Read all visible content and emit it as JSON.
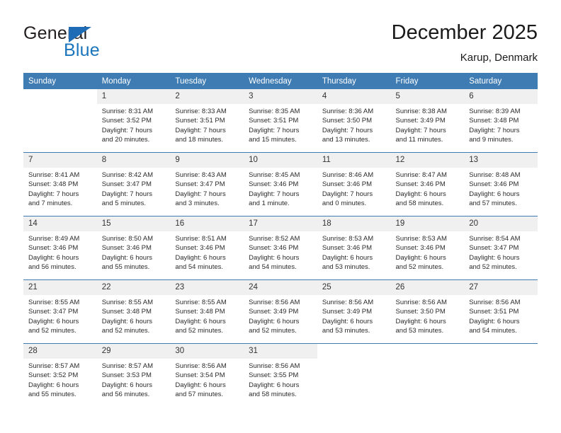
{
  "brand": {
    "name_top": "General",
    "name_bottom": "Blue",
    "accent_color": "#1b75bc",
    "triangle_color": "#1d6cb5"
  },
  "header": {
    "title": "December 2025",
    "subtitle": "Karup, Denmark"
  },
  "calendar": {
    "header_background": "#3f7cb3",
    "daynum_background": "#f0f0f0",
    "weekdays": [
      "Sunday",
      "Monday",
      "Tuesday",
      "Wednesday",
      "Thursday",
      "Friday",
      "Saturday"
    ],
    "weeks": [
      [
        {
          "day": "",
          "sunrise": "",
          "sunset": "",
          "daylight_line1": "",
          "daylight_line2": ""
        },
        {
          "day": "1",
          "sunrise": "Sunrise: 8:31 AM",
          "sunset": "Sunset: 3:52 PM",
          "daylight_line1": "Daylight: 7 hours",
          "daylight_line2": "and 20 minutes."
        },
        {
          "day": "2",
          "sunrise": "Sunrise: 8:33 AM",
          "sunset": "Sunset: 3:51 PM",
          "daylight_line1": "Daylight: 7 hours",
          "daylight_line2": "and 18 minutes."
        },
        {
          "day": "3",
          "sunrise": "Sunrise: 8:35 AM",
          "sunset": "Sunset: 3:51 PM",
          "daylight_line1": "Daylight: 7 hours",
          "daylight_line2": "and 15 minutes."
        },
        {
          "day": "4",
          "sunrise": "Sunrise: 8:36 AM",
          "sunset": "Sunset: 3:50 PM",
          "daylight_line1": "Daylight: 7 hours",
          "daylight_line2": "and 13 minutes."
        },
        {
          "day": "5",
          "sunrise": "Sunrise: 8:38 AM",
          "sunset": "Sunset: 3:49 PM",
          "daylight_line1": "Daylight: 7 hours",
          "daylight_line2": "and 11 minutes."
        },
        {
          "day": "6",
          "sunrise": "Sunrise: 8:39 AM",
          "sunset": "Sunset: 3:48 PM",
          "daylight_line1": "Daylight: 7 hours",
          "daylight_line2": "and 9 minutes."
        }
      ],
      [
        {
          "day": "7",
          "sunrise": "Sunrise: 8:41 AM",
          "sunset": "Sunset: 3:48 PM",
          "daylight_line1": "Daylight: 7 hours",
          "daylight_line2": "and 7 minutes."
        },
        {
          "day": "8",
          "sunrise": "Sunrise: 8:42 AM",
          "sunset": "Sunset: 3:47 PM",
          "daylight_line1": "Daylight: 7 hours",
          "daylight_line2": "and 5 minutes."
        },
        {
          "day": "9",
          "sunrise": "Sunrise: 8:43 AM",
          "sunset": "Sunset: 3:47 PM",
          "daylight_line1": "Daylight: 7 hours",
          "daylight_line2": "and 3 minutes."
        },
        {
          "day": "10",
          "sunrise": "Sunrise: 8:45 AM",
          "sunset": "Sunset: 3:46 PM",
          "daylight_line1": "Daylight: 7 hours",
          "daylight_line2": "and 1 minute."
        },
        {
          "day": "11",
          "sunrise": "Sunrise: 8:46 AM",
          "sunset": "Sunset: 3:46 PM",
          "daylight_line1": "Daylight: 7 hours",
          "daylight_line2": "and 0 minutes."
        },
        {
          "day": "12",
          "sunrise": "Sunrise: 8:47 AM",
          "sunset": "Sunset: 3:46 PM",
          "daylight_line1": "Daylight: 6 hours",
          "daylight_line2": "and 58 minutes."
        },
        {
          "day": "13",
          "sunrise": "Sunrise: 8:48 AM",
          "sunset": "Sunset: 3:46 PM",
          "daylight_line1": "Daylight: 6 hours",
          "daylight_line2": "and 57 minutes."
        }
      ],
      [
        {
          "day": "14",
          "sunrise": "Sunrise: 8:49 AM",
          "sunset": "Sunset: 3:46 PM",
          "daylight_line1": "Daylight: 6 hours",
          "daylight_line2": "and 56 minutes."
        },
        {
          "day": "15",
          "sunrise": "Sunrise: 8:50 AM",
          "sunset": "Sunset: 3:46 PM",
          "daylight_line1": "Daylight: 6 hours",
          "daylight_line2": "and 55 minutes."
        },
        {
          "day": "16",
          "sunrise": "Sunrise: 8:51 AM",
          "sunset": "Sunset: 3:46 PM",
          "daylight_line1": "Daylight: 6 hours",
          "daylight_line2": "and 54 minutes."
        },
        {
          "day": "17",
          "sunrise": "Sunrise: 8:52 AM",
          "sunset": "Sunset: 3:46 PM",
          "daylight_line1": "Daylight: 6 hours",
          "daylight_line2": "and 54 minutes."
        },
        {
          "day": "18",
          "sunrise": "Sunrise: 8:53 AM",
          "sunset": "Sunset: 3:46 PM",
          "daylight_line1": "Daylight: 6 hours",
          "daylight_line2": "and 53 minutes."
        },
        {
          "day": "19",
          "sunrise": "Sunrise: 8:53 AM",
          "sunset": "Sunset: 3:46 PM",
          "daylight_line1": "Daylight: 6 hours",
          "daylight_line2": "and 52 minutes."
        },
        {
          "day": "20",
          "sunrise": "Sunrise: 8:54 AM",
          "sunset": "Sunset: 3:47 PM",
          "daylight_line1": "Daylight: 6 hours",
          "daylight_line2": "and 52 minutes."
        }
      ],
      [
        {
          "day": "21",
          "sunrise": "Sunrise: 8:55 AM",
          "sunset": "Sunset: 3:47 PM",
          "daylight_line1": "Daylight: 6 hours",
          "daylight_line2": "and 52 minutes."
        },
        {
          "day": "22",
          "sunrise": "Sunrise: 8:55 AM",
          "sunset": "Sunset: 3:48 PM",
          "daylight_line1": "Daylight: 6 hours",
          "daylight_line2": "and 52 minutes."
        },
        {
          "day": "23",
          "sunrise": "Sunrise: 8:55 AM",
          "sunset": "Sunset: 3:48 PM",
          "daylight_line1": "Daylight: 6 hours",
          "daylight_line2": "and 52 minutes."
        },
        {
          "day": "24",
          "sunrise": "Sunrise: 8:56 AM",
          "sunset": "Sunset: 3:49 PM",
          "daylight_line1": "Daylight: 6 hours",
          "daylight_line2": "and 52 minutes."
        },
        {
          "day": "25",
          "sunrise": "Sunrise: 8:56 AM",
          "sunset": "Sunset: 3:49 PM",
          "daylight_line1": "Daylight: 6 hours",
          "daylight_line2": "and 53 minutes."
        },
        {
          "day": "26",
          "sunrise": "Sunrise: 8:56 AM",
          "sunset": "Sunset: 3:50 PM",
          "daylight_line1": "Daylight: 6 hours",
          "daylight_line2": "and 53 minutes."
        },
        {
          "day": "27",
          "sunrise": "Sunrise: 8:56 AM",
          "sunset": "Sunset: 3:51 PM",
          "daylight_line1": "Daylight: 6 hours",
          "daylight_line2": "and 54 minutes."
        }
      ],
      [
        {
          "day": "28",
          "sunrise": "Sunrise: 8:57 AM",
          "sunset": "Sunset: 3:52 PM",
          "daylight_line1": "Daylight: 6 hours",
          "daylight_line2": "and 55 minutes."
        },
        {
          "day": "29",
          "sunrise": "Sunrise: 8:57 AM",
          "sunset": "Sunset: 3:53 PM",
          "daylight_line1": "Daylight: 6 hours",
          "daylight_line2": "and 56 minutes."
        },
        {
          "day": "30",
          "sunrise": "Sunrise: 8:56 AM",
          "sunset": "Sunset: 3:54 PM",
          "daylight_line1": "Daylight: 6 hours",
          "daylight_line2": "and 57 minutes."
        },
        {
          "day": "31",
          "sunrise": "Sunrise: 8:56 AM",
          "sunset": "Sunset: 3:55 PM",
          "daylight_line1": "Daylight: 6 hours",
          "daylight_line2": "and 58 minutes."
        },
        {
          "day": "",
          "sunrise": "",
          "sunset": "",
          "daylight_line1": "",
          "daylight_line2": ""
        },
        {
          "day": "",
          "sunrise": "",
          "sunset": "",
          "daylight_line1": "",
          "daylight_line2": ""
        },
        {
          "day": "",
          "sunrise": "",
          "sunset": "",
          "daylight_line1": "",
          "daylight_line2": ""
        }
      ]
    ]
  }
}
